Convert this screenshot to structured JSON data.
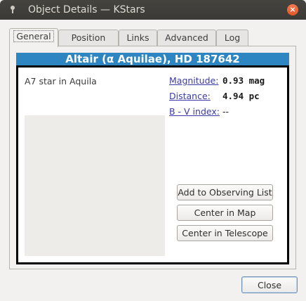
{
  "window": {
    "title": "Object Details — KStars",
    "close_glyph": "×"
  },
  "tabs": [
    {
      "label": "General",
      "active": true
    },
    {
      "label": "Position",
      "active": false
    },
    {
      "label": "Links",
      "active": false
    },
    {
      "label": "Advanced",
      "active": false
    },
    {
      "label": "Log",
      "active": false
    }
  ],
  "object": {
    "name": "Altair (α Aquilae), HD 187642",
    "description": "A7 star in Aquila",
    "properties": [
      {
        "label": "Magnitude:",
        "value": "0.93 mag"
      },
      {
        "label": "Distance:",
        "value": "4.94 pc"
      },
      {
        "label": "B - V index:",
        "value": "--"
      }
    ]
  },
  "actions": {
    "add_observing": "Add to Observing List",
    "center_map": "Center in Map",
    "center_telescope": "Center in Telescope"
  },
  "footer": {
    "close_label": "Close"
  },
  "colors": {
    "name_bar": "#2d86c2",
    "link_text": "#3a3aa8",
    "titlebar": "#3b3a36",
    "close_button": "#e2572b"
  }
}
